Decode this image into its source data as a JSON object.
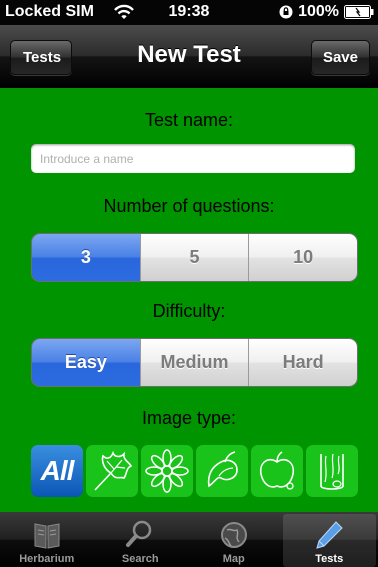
{
  "status_bar": {
    "carrier": "Locked SIM",
    "time": "19:38",
    "battery": "100%"
  },
  "nav": {
    "back_label": "Tests",
    "title": "New Test",
    "save_label": "Save"
  },
  "form": {
    "name_label": "Test name:",
    "name_placeholder": "Introduce a name",
    "name_value": "",
    "questions_label": "Number of questions:",
    "questions_options": [
      "3",
      "5",
      "10"
    ],
    "questions_selected": "3",
    "difficulty_label": "Difficulty:",
    "difficulty_options": [
      "Easy",
      "Medium",
      "Hard"
    ],
    "difficulty_selected": "Easy",
    "image_type_label": "Image type:",
    "image_types": [
      {
        "name": "all",
        "label": "All",
        "selected": true
      },
      {
        "name": "leaf-icon",
        "selected": false
      },
      {
        "name": "flower-icon",
        "selected": false
      },
      {
        "name": "seed-pod-icon",
        "selected": false
      },
      {
        "name": "fruit-icon",
        "selected": false
      },
      {
        "name": "bark-icon",
        "selected": false
      }
    ]
  },
  "tabs": [
    {
      "label": "Herbarium",
      "icon": "book-icon",
      "active": false
    },
    {
      "label": "Search",
      "icon": "search-icon",
      "active": false
    },
    {
      "label": "Map",
      "icon": "globe-icon",
      "active": false
    },
    {
      "label": "Tests",
      "icon": "pencil-icon",
      "active": true
    }
  ],
  "colors": {
    "background": "#009500",
    "accent": "#2a66dc",
    "image_type_tile": "#1ac31a"
  }
}
